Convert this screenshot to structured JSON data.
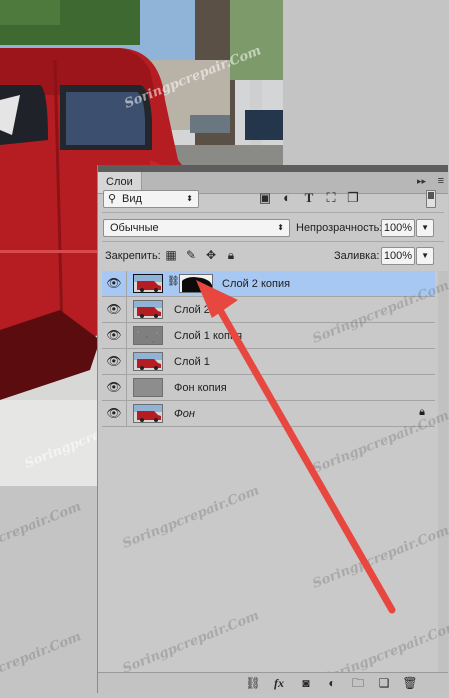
{
  "panel": {
    "tab_label": "Слои",
    "collapse_label": "▸▸",
    "menu_label": "≡",
    "filter_kind": "Вид",
    "blend_mode": "Обычные",
    "opacity_label": "Непрозрачность:",
    "opacity_value": "100%",
    "lock_label": "Закрепить:",
    "fill_label": "Заливка:",
    "fill_value": "100%"
  },
  "layers": [
    {
      "name": "Слой 2 копия",
      "selected": true,
      "has_mask": true,
      "thumb": "car"
    },
    {
      "name": "Слой 2",
      "selected": false,
      "has_mask": false,
      "thumb": "car"
    },
    {
      "name": "Слой 1 копия",
      "selected": false,
      "has_mask": false,
      "thumb": "noise"
    },
    {
      "name": "Слой 1",
      "selected": false,
      "has_mask": false,
      "thumb": "car"
    },
    {
      "name": "Фон копия",
      "selected": false,
      "has_mask": false,
      "thumb": "gray"
    },
    {
      "name": "Фон",
      "selected": false,
      "has_mask": false,
      "thumb": "car",
      "locked": true
    }
  ],
  "watermark": "Soringpcrepair.Com",
  "colors": {
    "selected_row": "#a6c8f2",
    "arrow": "#e8473f",
    "car_red": "#b51d22"
  },
  "icons": {
    "visibility": "eye-icon",
    "link": "chain-icon",
    "lock": "lock-icon"
  }
}
